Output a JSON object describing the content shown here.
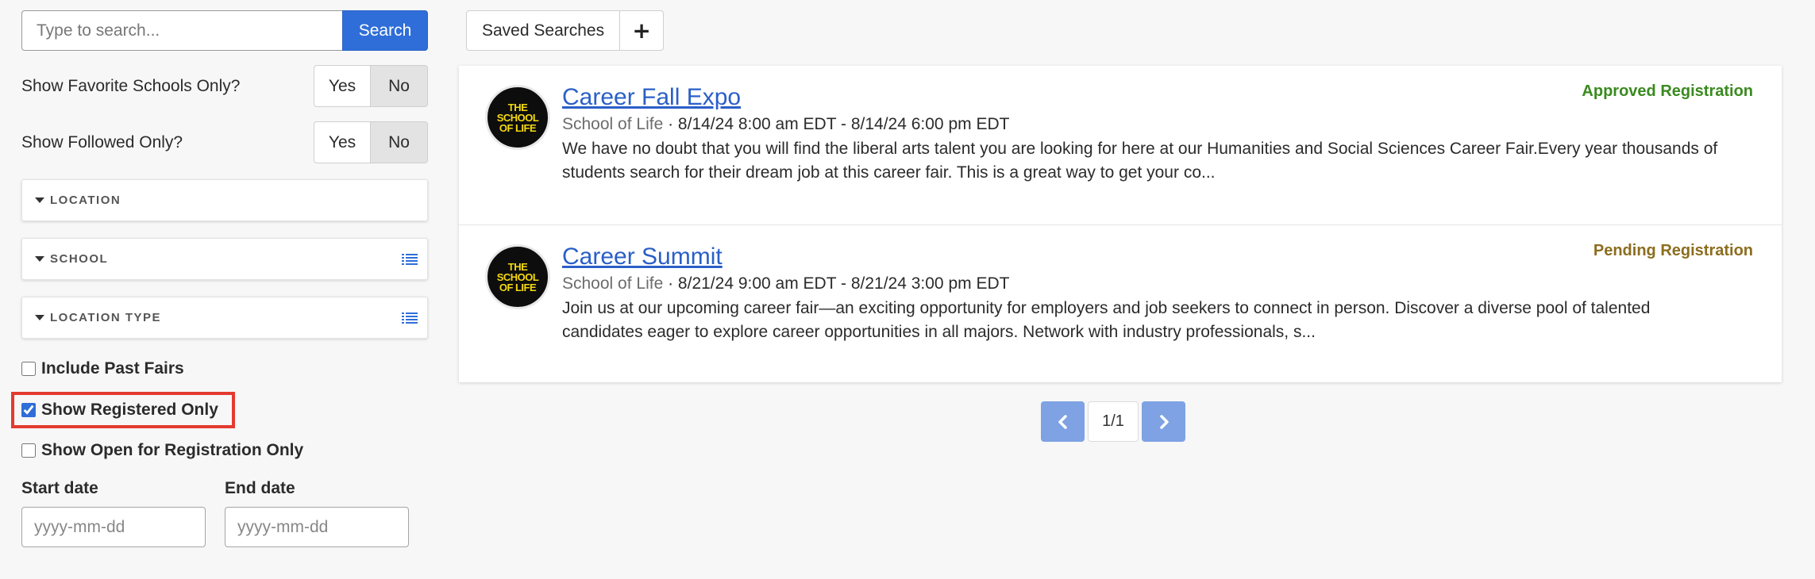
{
  "search": {
    "placeholder": "Type to search...",
    "button_label": "Search"
  },
  "filters": {
    "favorite_schools": {
      "label": "Show Favorite Schools Only?",
      "yes": "Yes",
      "no": "No",
      "selected": "No"
    },
    "followed": {
      "label": "Show Followed Only?",
      "yes": "Yes",
      "no": "No",
      "selected": "No"
    },
    "panels": [
      {
        "label": "LOCATION",
        "has_list_icon": false
      },
      {
        "label": "SCHOOL",
        "has_list_icon": true
      },
      {
        "label": "LOCATION TYPE",
        "has_list_icon": true
      }
    ],
    "checkboxes": [
      {
        "label": "Include Past Fairs",
        "checked": false
      },
      {
        "label": "Show Registered Only",
        "checked": true
      },
      {
        "label": "Show Open for Registration Only",
        "checked": false
      }
    ],
    "start_date": {
      "label": "Start date",
      "placeholder": "yyyy-mm-dd"
    },
    "end_date": {
      "label": "End date",
      "placeholder": "yyyy-mm-dd"
    }
  },
  "saved_searches": {
    "label": "Saved Searches",
    "add_icon": "plus-icon"
  },
  "fairs": [
    {
      "title": "Career Fall Expo",
      "school": "School of Life",
      "dates": "· 8/14/24 8:00 am EDT - 8/14/24 6:00 pm EDT",
      "description": "We have no doubt that you will find the liberal arts talent you are looking for here at our Humanities and Social Sciences Career Fair.Every year thousands of students search for their dream job at this career fair. This is a great way to get your co...",
      "status": "Approved Registration",
      "status_color": "#3a8a1f",
      "logo_lines": [
        "THE",
        "SCHOOL",
        "OF LIFE"
      ]
    },
    {
      "title": "Career Summit",
      "school": "School of Life",
      "dates": "· 8/21/24 9:00 am EDT - 8/21/24 3:00 pm EDT",
      "description": "Join us at our upcoming career fair—an exciting opportunity for employers and job seekers to connect in person. Discover a diverse pool of talented candidates eager to explore career opportunities in all majors. Network with industry professionals, s...",
      "status": "Pending Registration",
      "status_color": "#8c6d1f",
      "logo_lines": [
        "THE",
        "SCHOOL",
        "OF LIFE"
      ]
    }
  ],
  "pagination": {
    "label": "1/1"
  },
  "colors": {
    "accent": "#2f6ed8",
    "highlight": "#e43a2f"
  }
}
